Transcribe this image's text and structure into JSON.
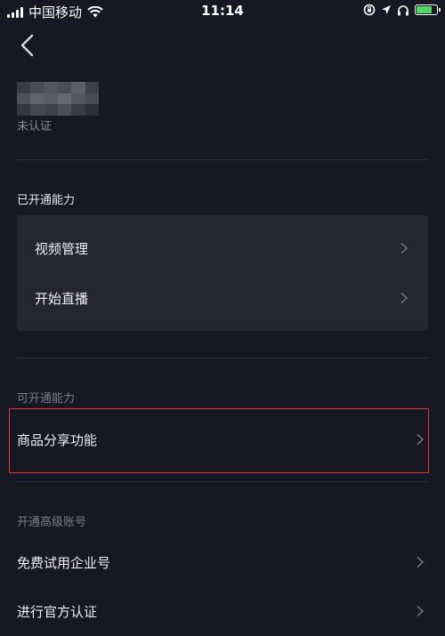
{
  "status_bar": {
    "carrier": "中国移动",
    "time": "11:14"
  },
  "profile": {
    "status": "未认证"
  },
  "enabled_section": {
    "title": "已开通能力",
    "items": [
      {
        "label": "视频管理"
      },
      {
        "label": "开始直播"
      }
    ]
  },
  "available_section": {
    "title": "可开通能力",
    "items": [
      {
        "label": "商品分享功能"
      }
    ]
  },
  "upgrade_section": {
    "title": "开通高级账号",
    "items": [
      {
        "label": "免费试用企业号"
      },
      {
        "label": "进行官方认证"
      }
    ]
  },
  "colors": {
    "background": "#161823",
    "card": "#252632",
    "highlight_border": "#e2352c",
    "battery_green": "#4cd964"
  },
  "icons": [
    "signal-icon",
    "wifi-icon",
    "orientation-lock-icon",
    "location-icon",
    "headphones-icon",
    "battery-icon",
    "back-arrow-icon",
    "chevron-right-icon"
  ]
}
